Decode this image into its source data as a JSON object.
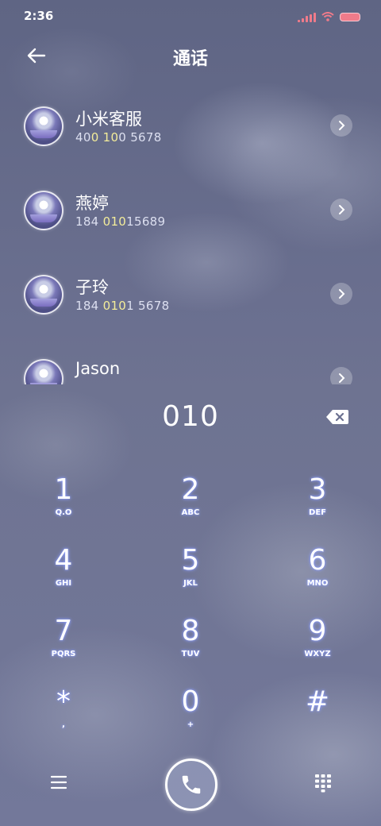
{
  "status_bar": {
    "time": "2:36",
    "icons": [
      "signal-icon",
      "wifi-icon",
      "battery-icon"
    ],
    "accent_color": "#f07b8a"
  },
  "header": {
    "title": "通话",
    "back_icon": "back-arrow-icon"
  },
  "contacts": [
    {
      "name": "小米客服",
      "number_parts": [
        "40",
        "0 10",
        "0 5678"
      ]
    },
    {
      "name": "燕婷",
      "number_parts": [
        "184 ",
        "010",
        "15689"
      ]
    },
    {
      "name": "子玲",
      "number_parts": [
        "184 ",
        "010",
        "1 5678"
      ]
    },
    {
      "name": "Jason",
      "number_parts": [
        "",
        "",
        ""
      ]
    }
  ],
  "highlight_color": "#f3ec9a",
  "dialer": {
    "entered": "010",
    "keys": [
      {
        "digit": "1",
        "letters": "Q.O"
      },
      {
        "digit": "2",
        "letters": "ABC"
      },
      {
        "digit": "3",
        "letters": "DEF"
      },
      {
        "digit": "4",
        "letters": "GHI"
      },
      {
        "digit": "5",
        "letters": "JKL"
      },
      {
        "digit": "6",
        "letters": "MNO"
      },
      {
        "digit": "7",
        "letters": "PQRS"
      },
      {
        "digit": "8",
        "letters": "TUV"
      },
      {
        "digit": "9",
        "letters": "WXYZ"
      },
      {
        "digit": "*",
        "letters": ","
      },
      {
        "digit": "0",
        "letters": "+"
      },
      {
        "digit": "#",
        "letters": ""
      }
    ]
  },
  "bottom_bar": {
    "left_icon": "menu-icon",
    "center_icon": "phone-icon",
    "right_icon": "keypad-icon"
  }
}
